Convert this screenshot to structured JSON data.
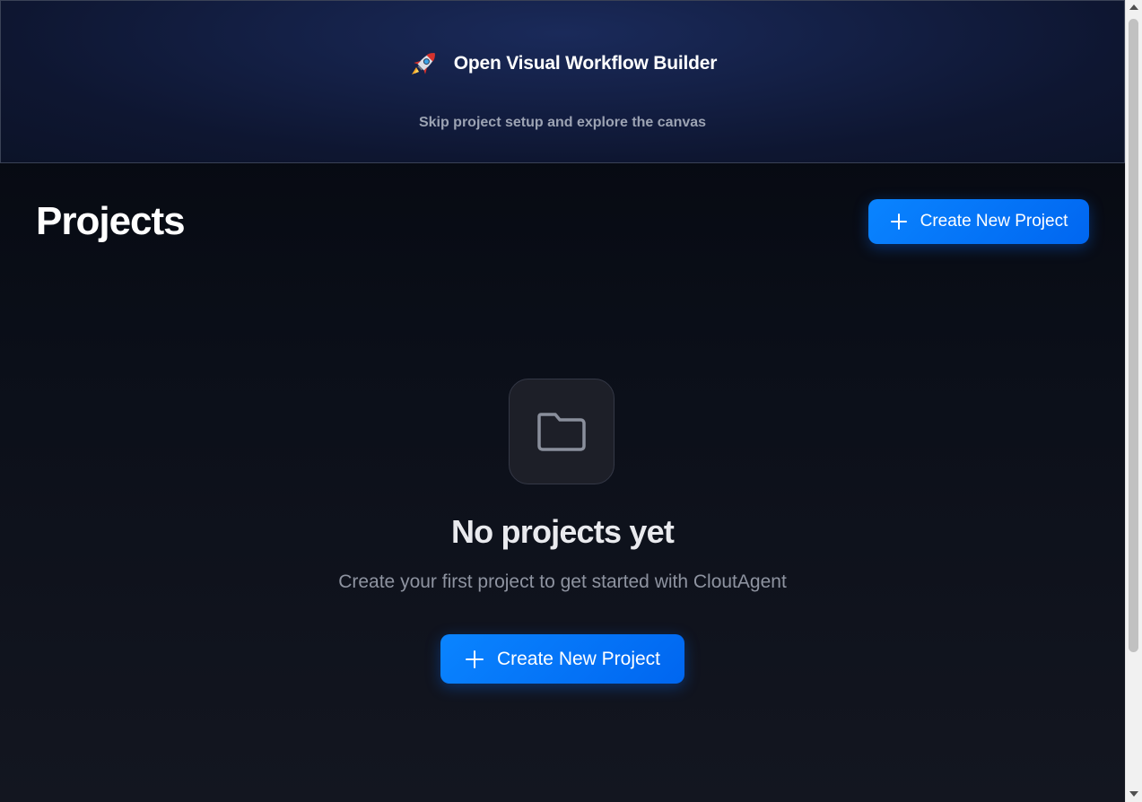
{
  "banner": {
    "title": "Open Visual Workflow Builder",
    "subtitle": "Skip project setup and explore the canvas",
    "icon": "rocket-icon"
  },
  "page": {
    "title": "Projects",
    "create_button_label": "Create New Project"
  },
  "empty_state": {
    "icon": "folder-icon",
    "title": "No projects yet",
    "description": "Create your first project to get started with CloutAgent",
    "create_button_label": "Create New Project"
  },
  "colors": {
    "accent": "#0a84ff",
    "background": "#0b0f19",
    "banner_background": "#142046"
  }
}
